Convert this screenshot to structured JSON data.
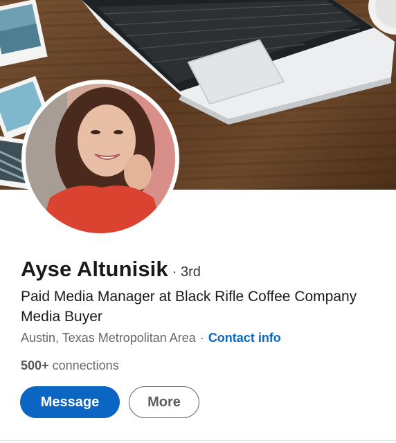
{
  "profile": {
    "name": "Ayse Altunisik",
    "degree": "· 3rd",
    "headline": "Paid Media Manager at Black Rifle Coffee Company Media Buyer",
    "location": "Austin, Texas Metropolitan Area",
    "location_separator": "·",
    "contact_info_label": "Contact info",
    "connections_count": "500+",
    "connections_label": "connections"
  },
  "actions": {
    "message_label": "Message",
    "more_label": "More"
  },
  "colors": {
    "accent": "#0a66c2",
    "text_primary": "#1a1a1a",
    "text_secondary": "#666666"
  }
}
